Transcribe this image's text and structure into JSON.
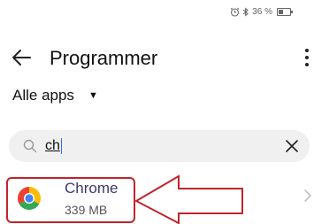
{
  "status_bar": {
    "battery_percent": "36 %",
    "battery_level": 0.36
  },
  "header": {
    "title": "Programmer"
  },
  "filter": {
    "label": "Alle apps"
  },
  "search": {
    "value": "ch"
  },
  "app": {
    "name": "Chrome",
    "size": "339 MB"
  },
  "colors": {
    "highlight": "#c0242b"
  },
  "icons": {
    "alarm": "alarm-icon",
    "bluetooth": "bluetooth-icon",
    "battery": "battery-icon",
    "back": "arrow-left-icon",
    "more": "more-vertical-icon",
    "dropdown": "caret-down-icon",
    "search": "search-icon",
    "clear": "close-icon",
    "app": "chrome-icon",
    "chevron": "chevron-right-icon"
  }
}
